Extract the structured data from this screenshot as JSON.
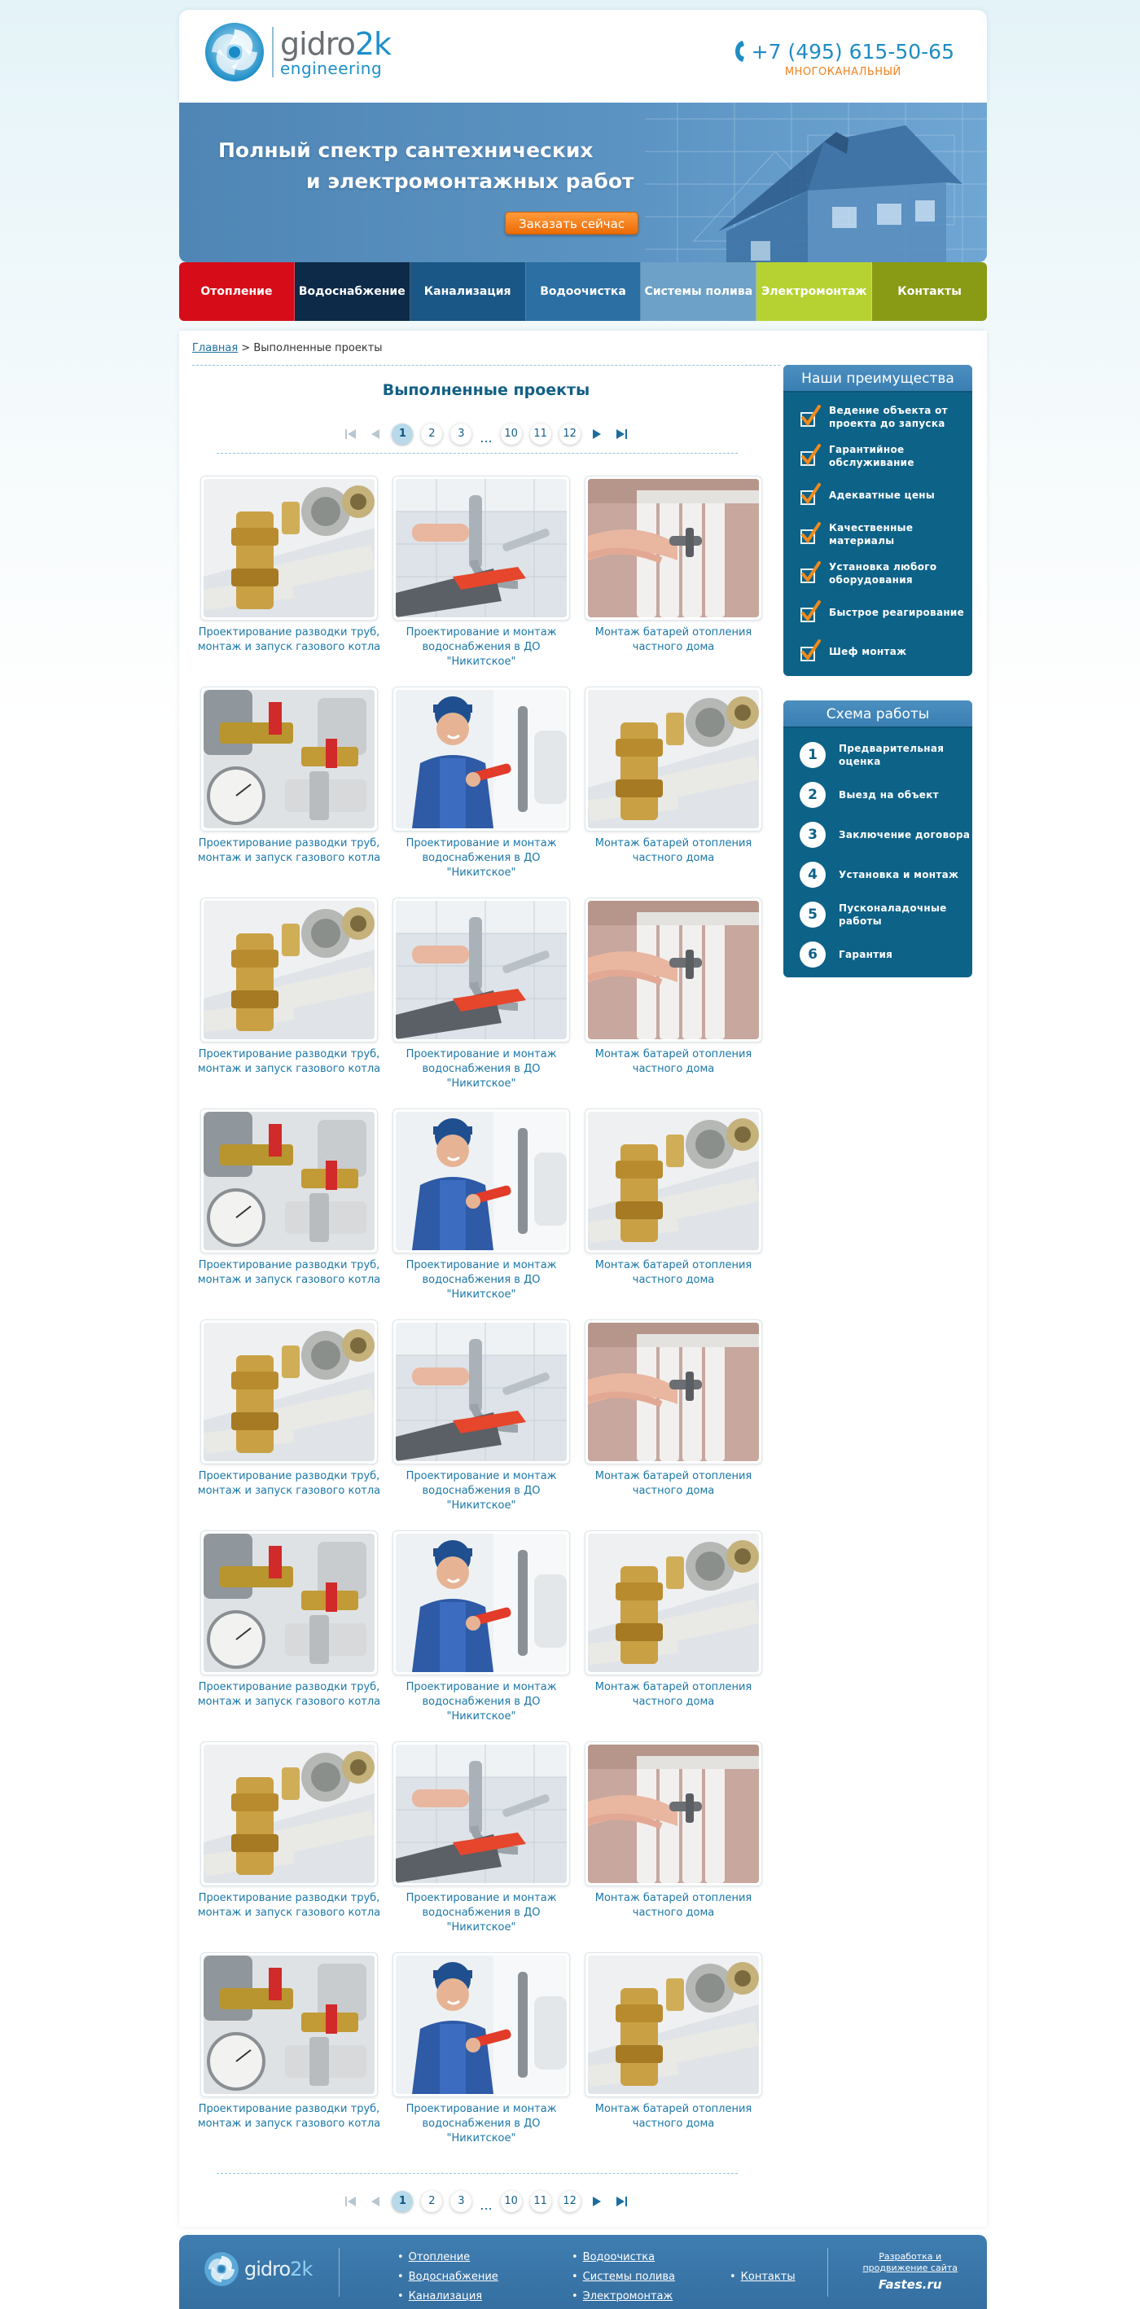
{
  "header": {
    "logo_name_main": "gidro",
    "logo_name_accent": "2k",
    "logo_sub": "engineering",
    "phone": "+7 (495) 615-50-65",
    "phone_note": "МНОГОКАНАЛЬНЫЙ"
  },
  "banner": {
    "title_line1": "Полный спектр сантехнических",
    "title_line2": "и электромонтажных работ",
    "cta": "Заказать сейчас"
  },
  "nav": [
    {
      "label": "Отопление",
      "color": "#d60c18"
    },
    {
      "label": "Водоснабжение",
      "color": "#0d2a48"
    },
    {
      "label": "Канализация",
      "color": "#1a5686"
    },
    {
      "label": "Водоочистка",
      "color": "#2b6fa3"
    },
    {
      "label": "Системы полива",
      "color": "#6da1c7"
    },
    {
      "label": "Электромонтаж",
      "color": "#b6d232"
    },
    {
      "label": "Контакты",
      "color": "#899a15"
    }
  ],
  "breadcrumb": {
    "home": "Главная",
    "separator": ">",
    "current": "Выполненные проекты"
  },
  "page_title": "Выполненные проекты",
  "pagination": {
    "pages": [
      "1",
      "2",
      "3",
      "10",
      "11",
      "12"
    ],
    "ellipsis": "...",
    "active_page": "1"
  },
  "projects": [
    {
      "caption": "Проектирование разводки труб, монтаж и запуск газового котла",
      "image": "fittings"
    },
    {
      "caption": "Проектирование и монтаж водоснабжения в ДО \"Никитское\"",
      "image": "sink-wrench"
    },
    {
      "caption": "Монтаж батарей отопления частного дома",
      "image": "radiator"
    },
    {
      "caption": "Проектирование разводки труб, монтаж и запуск газового котла",
      "image": "valves"
    },
    {
      "caption": "Проектирование и монтаж водоснабжения в ДО \"Никитское\"",
      "image": "plumber"
    },
    {
      "caption": "Монтаж батарей отопления частного дома",
      "image": "fittings"
    },
    {
      "caption": "Проектирование разводки труб, монтаж и запуск газового котла",
      "image": "fittings"
    },
    {
      "caption": "Проектирование и монтаж водоснабжения в ДО \"Никитское\"",
      "image": "sink-wrench"
    },
    {
      "caption": "Монтаж батарей отопления частного дома",
      "image": "radiator"
    },
    {
      "caption": "Проектирование разводки труб, монтаж и запуск газового котла",
      "image": "valves"
    },
    {
      "caption": "Проектирование и монтаж водоснабжения в ДО \"Никитское\"",
      "image": "plumber"
    },
    {
      "caption": "Монтаж батарей отопления частного дома",
      "image": "fittings"
    },
    {
      "caption": "Проектирование разводки труб, монтаж и запуск газового котла",
      "image": "fittings"
    },
    {
      "caption": "Проектирование и монтаж водоснабжения в ДО \"Никитское\"",
      "image": "sink-wrench"
    },
    {
      "caption": "Монтаж батарей отопления частного дома",
      "image": "radiator"
    },
    {
      "caption": "Проектирование разводки труб, монтаж и запуск газового котла",
      "image": "valves"
    },
    {
      "caption": "Проектирование и монтаж водоснабжения в ДО \"Никитское\"",
      "image": "plumber"
    },
    {
      "caption": "Монтаж батарей отопления частного дома",
      "image": "fittings"
    },
    {
      "caption": "Проектирование разводки труб, монтаж и запуск газового котла",
      "image": "fittings"
    },
    {
      "caption": "Проектирование и монтаж водоснабжения в ДО \"Никитское\"",
      "image": "sink-wrench"
    },
    {
      "caption": "Монтаж батарей отопления частного дома",
      "image": "radiator"
    },
    {
      "caption": "Проектирование разводки труб, монтаж и запуск газового котла",
      "image": "valves"
    },
    {
      "caption": "Проектирование и монтаж водоснабжения в ДО \"Никитское\"",
      "image": "plumber"
    },
    {
      "caption": "Монтаж батарей отопления частного дома",
      "image": "fittings"
    }
  ],
  "advantages": {
    "title": "Наши преимущества",
    "items": [
      "Ведение объекта от проекта до запуска",
      "Гарантийное обслуживание",
      "Адекватные цены",
      "Качественные материалы",
      "Установка любого оборудования",
      "Быстрое реагирование",
      "Шеф монтаж"
    ]
  },
  "workflow": {
    "title": "Схема работы",
    "steps": [
      {
        "num": "1",
        "label": "Предварительная оценка"
      },
      {
        "num": "2",
        "label": "Выезд на объект"
      },
      {
        "num": "3",
        "label": "Заключение договора"
      },
      {
        "num": "4",
        "label": "Установка и монтаж"
      },
      {
        "num": "5",
        "label": "Пусконаладочные работы"
      },
      {
        "num": "6",
        "label": "Гарантия"
      }
    ]
  },
  "footer": {
    "logo_name_main": "gidro",
    "logo_name_accent": "2k",
    "col1": [
      "Отопление",
      "Водоснабжение",
      "Канализация"
    ],
    "col2": [
      "Водоочистка",
      "Системы полива",
      "Электромонтаж"
    ],
    "col3": [
      "Контакты"
    ],
    "dev_line1": "Разработка и",
    "dev_line2": "продвижение сайта",
    "dev_brand": "Fastes.ru"
  },
  "colors": {
    "brand_blue": "#1e8fc9",
    "accent_orange": "#f08220",
    "sidebar_bg": "#0d6288",
    "link_blue": "#1a77a8"
  }
}
